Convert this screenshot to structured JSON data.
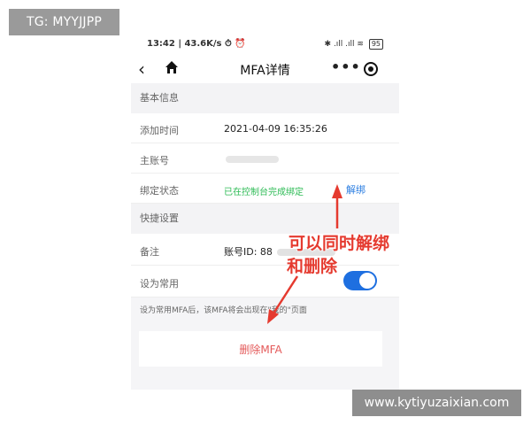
{
  "watermarks": {
    "tg": "TG: MYYJJPP",
    "site": "www.kytiyuzaixian.com"
  },
  "statusbar": {
    "time": "13:42 | 43.6K/s ⏱ ⏰",
    "icons": "✱ .ıll .ıll ≋",
    "battery": "95"
  },
  "navbar": {
    "back_icon": "chevron-left-icon",
    "home_icon": "home-icon",
    "title": "MFA详情",
    "more": "•••",
    "close_icon": "target-circle-icon"
  },
  "sections": {
    "basic": "基本信息",
    "quick": "快捷设置"
  },
  "rows": {
    "added_time": {
      "label": "添加时间",
      "value": "2021-04-09 16:35:26"
    },
    "main_account": {
      "label": "主账号",
      "value": ""
    },
    "binding_status": {
      "label": "绑定状态",
      "value": "已在控制台完成绑定",
      "action": "解绑"
    },
    "remark": {
      "label": "备注",
      "value": "账号ID: 88"
    },
    "set_common": {
      "label": "设为常用",
      "toggle_on": true
    }
  },
  "hint": "设为常用MFA后，该MFA将会出现在\"我的\"页面",
  "delete_button": "删除MFA",
  "annotation": {
    "line1": "可以同时解绑",
    "line2": "和删除",
    "color": "#e53a2f"
  },
  "colors": {
    "accent_blue": "#1e6fe0",
    "link_blue": "#2a7de1",
    "green": "#2dbb55",
    "delete_red": "#e45a5a"
  }
}
